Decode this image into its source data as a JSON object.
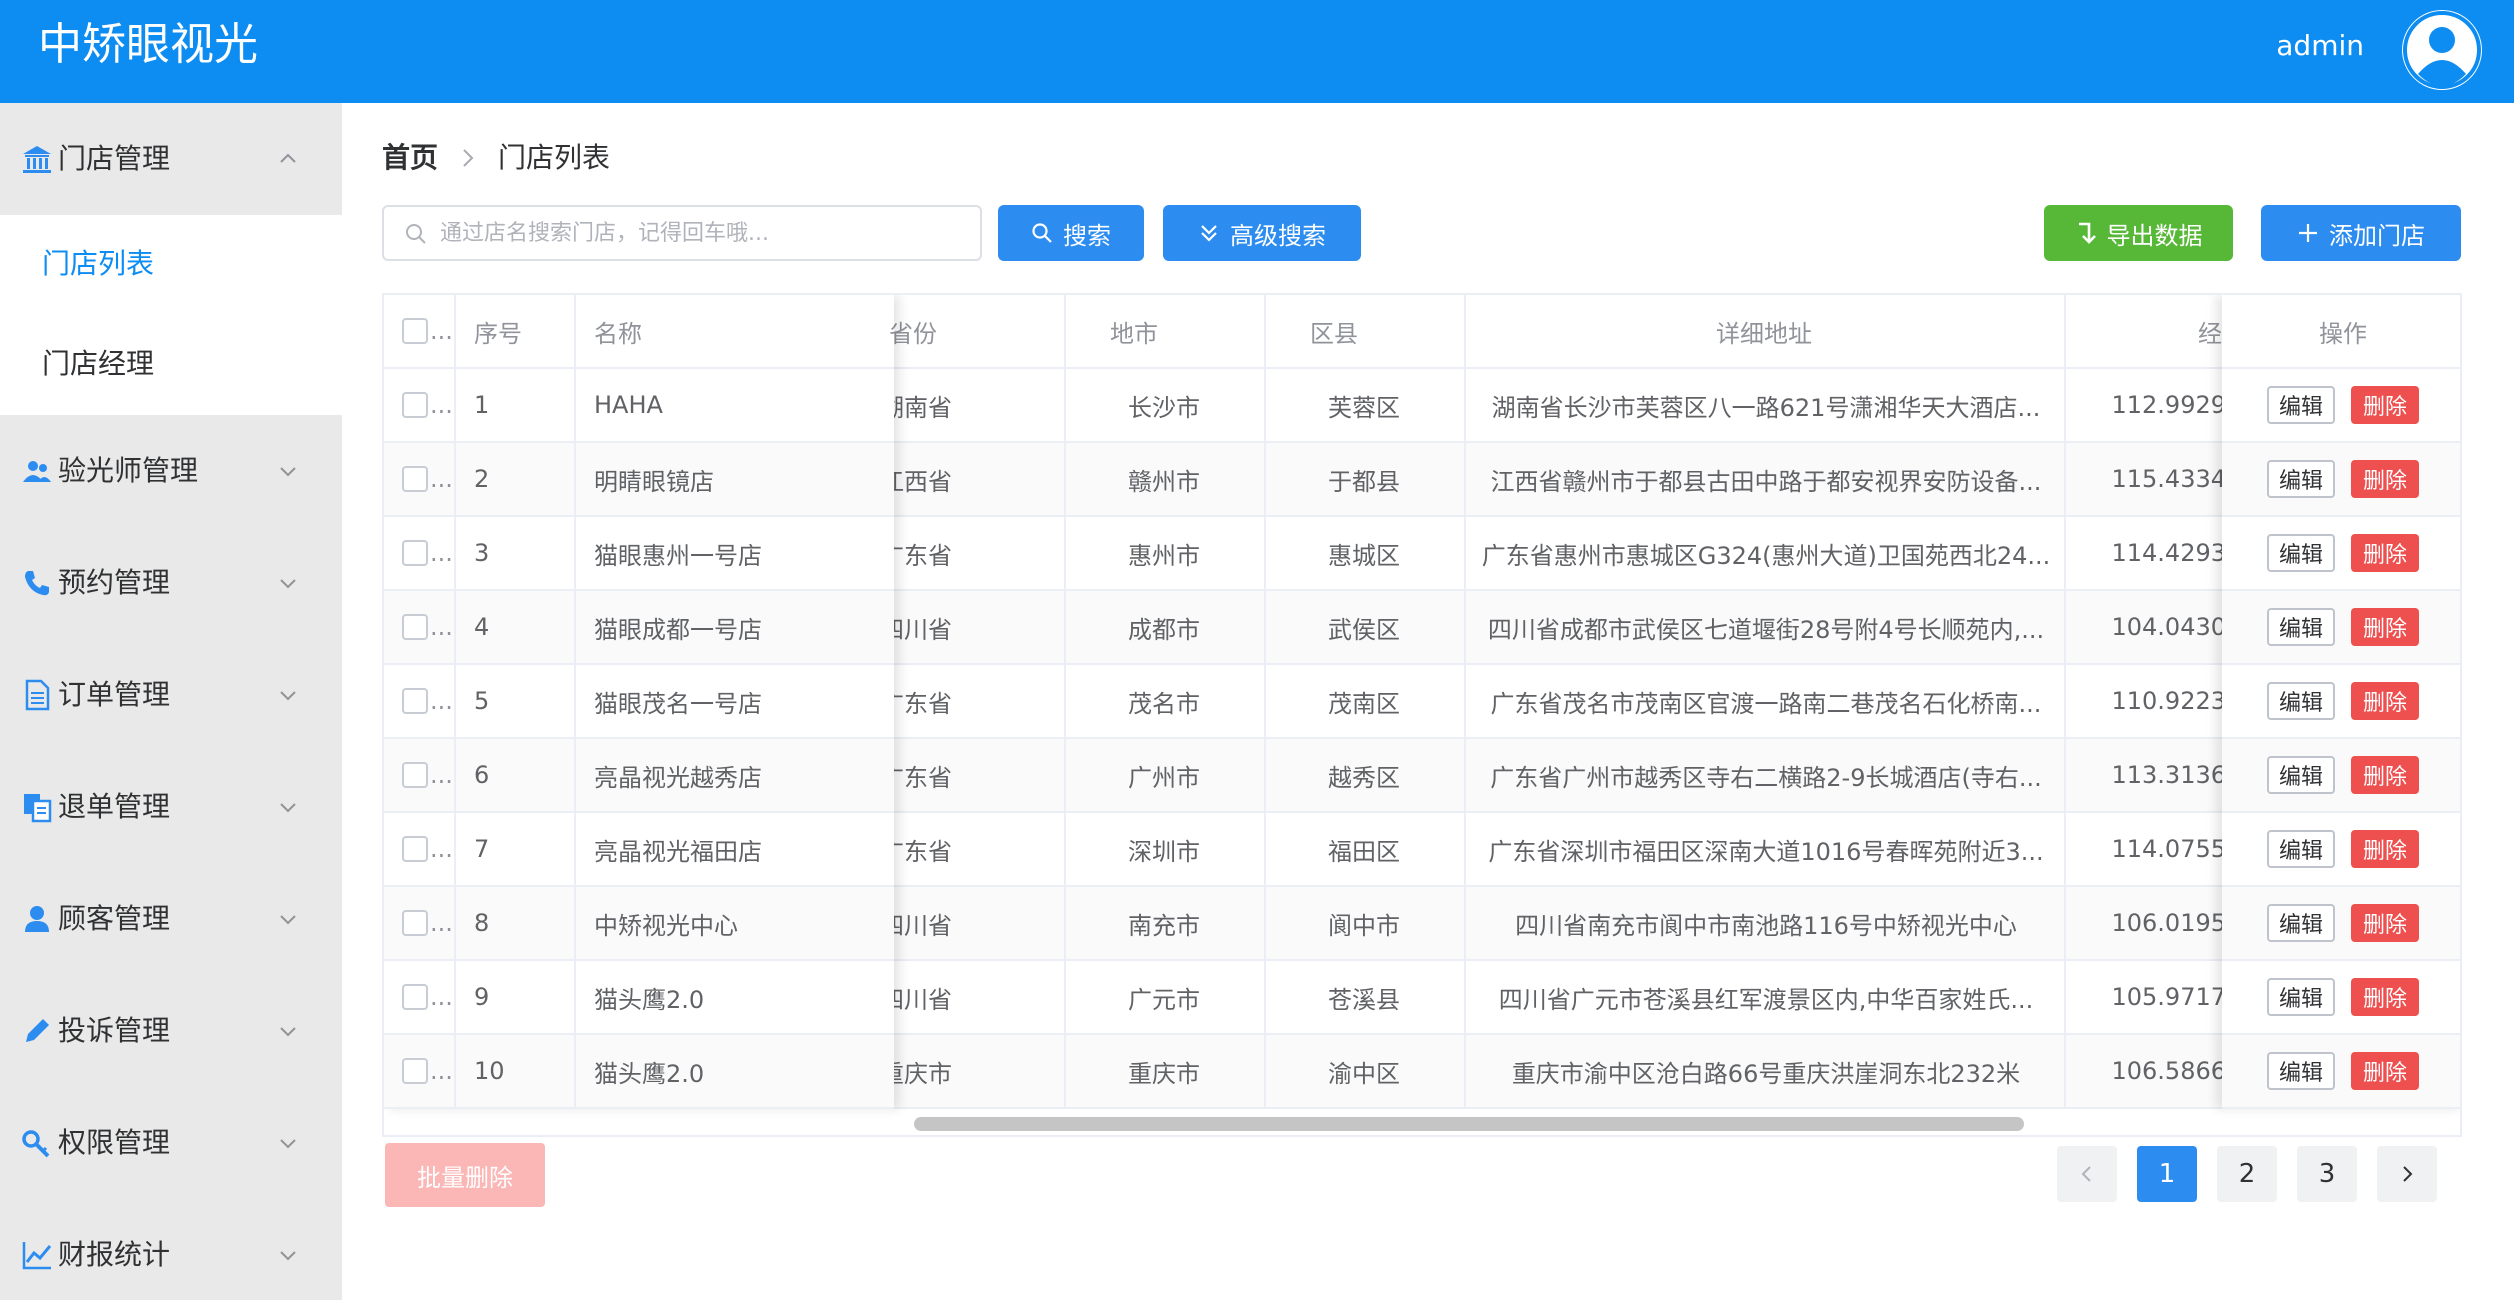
{
  "header": {
    "brand": "中矫眼视光",
    "username": "admin"
  },
  "sidebar": {
    "groups": [
      {
        "label": "门店管理",
        "icon": "bank-icon",
        "expanded": true
      },
      {
        "label": "验光师管理",
        "icon": "user-group-icon"
      },
      {
        "label": "预约管理",
        "icon": "phone-icon"
      },
      {
        "label": "订单管理",
        "icon": "document-icon"
      },
      {
        "label": "退单管理",
        "icon": "copy-icon"
      },
      {
        "label": "顾客管理",
        "icon": "user-icon"
      },
      {
        "label": "投诉管理",
        "icon": "pencil-icon"
      },
      {
        "label": "权限管理",
        "icon": "key-icon"
      },
      {
        "label": "财报统计",
        "icon": "chart-icon"
      }
    ],
    "subitems": [
      {
        "label": "门店列表",
        "active": true
      },
      {
        "label": "门店经理"
      }
    ]
  },
  "breadcrumb": {
    "home": "首页",
    "current": "门店列表"
  },
  "toolbar": {
    "search_placeholder": "通过店名搜索门店，记得回车哦...",
    "search_btn": "搜索",
    "advanced_btn": "高级搜索",
    "export_btn": "导出数据",
    "add_btn": "添加门店"
  },
  "table": {
    "headers": {
      "select": "...",
      "index": "序号",
      "name": "名称",
      "province": "省份",
      "city": "地市",
      "district": "区县",
      "address": "详细地址",
      "lng": "经",
      "actions": "操作"
    },
    "edit_label": "编辑",
    "delete_label": "删除",
    "rows": [
      {
        "index": "1",
        "name": "HAHA",
        "province": "湖南省",
        "city": "长沙市",
        "district": "芙蓉区",
        "address": "湖南省长沙市芙蓉区八一路621号潇湘华天大酒店...",
        "lng": "112.9929"
      },
      {
        "index": "2",
        "name": "明睛眼镜店",
        "province": "江西省",
        "city": "赣州市",
        "district": "于都县",
        "address": "江西省赣州市于都县古田中路于都安视界安防设备...",
        "lng": "115.4334"
      },
      {
        "index": "3",
        "name": "猫眼惠州一号店",
        "province": "广东省",
        "city": "惠州市",
        "district": "惠城区",
        "address": "广东省惠州市惠城区G324(惠州大道)卫国苑西北24...",
        "lng": "114.4293"
      },
      {
        "index": "4",
        "name": "猫眼成都一号店",
        "province": "四川省",
        "city": "成都市",
        "district": "武侯区",
        "address": "四川省成都市武侯区七道堰街28号附4号长顺苑内,...",
        "lng": "104.0430"
      },
      {
        "index": "5",
        "name": "猫眼茂名一号店",
        "province": "广东省",
        "city": "茂名市",
        "district": "茂南区",
        "address": "广东省茂名市茂南区官渡一路南二巷茂名石化桥南...",
        "lng": "110.9223"
      },
      {
        "index": "6",
        "name": "亮晶视光越秀店",
        "province": "广东省",
        "city": "广州市",
        "district": "越秀区",
        "address": "广东省广州市越秀区寺右二横路2-9长城酒店(寺右...",
        "lng": "113.3136"
      },
      {
        "index": "7",
        "name": "亮晶视光福田店",
        "province": "广东省",
        "city": "深圳市",
        "district": "福田区",
        "address": "广东省深圳市福田区深南大道1016号春晖苑附近3...",
        "lng": "114.0755"
      },
      {
        "index": "8",
        "name": "中矫视光中心",
        "province": "四川省",
        "city": "南充市",
        "district": "阆中市",
        "address": "四川省南充市阆中市南池路116号中矫视光中心",
        "lng": "106.0195"
      },
      {
        "index": "9",
        "name": "猫头鹰2.0",
        "province": "四川省",
        "city": "广元市",
        "district": "苍溪县",
        "address": "四川省广元市苍溪县红军渡景区内,中华百家姓氏...",
        "lng": "105.9717"
      },
      {
        "index": "10",
        "name": "猫头鹰2.0",
        "province": "重庆市",
        "city": "重庆市",
        "district": "渝中区",
        "address": "重庆市渝中区沧白路66号重庆洪崖洞东北232米",
        "lng": "106.5866"
      }
    ]
  },
  "batch_delete": "批量删除",
  "pagination": {
    "pages": [
      "1",
      "2",
      "3"
    ],
    "current": "1"
  },
  "colors": {
    "primary": "#0d8cf2",
    "success": "#57b838",
    "danger": "#ee4f4f"
  }
}
